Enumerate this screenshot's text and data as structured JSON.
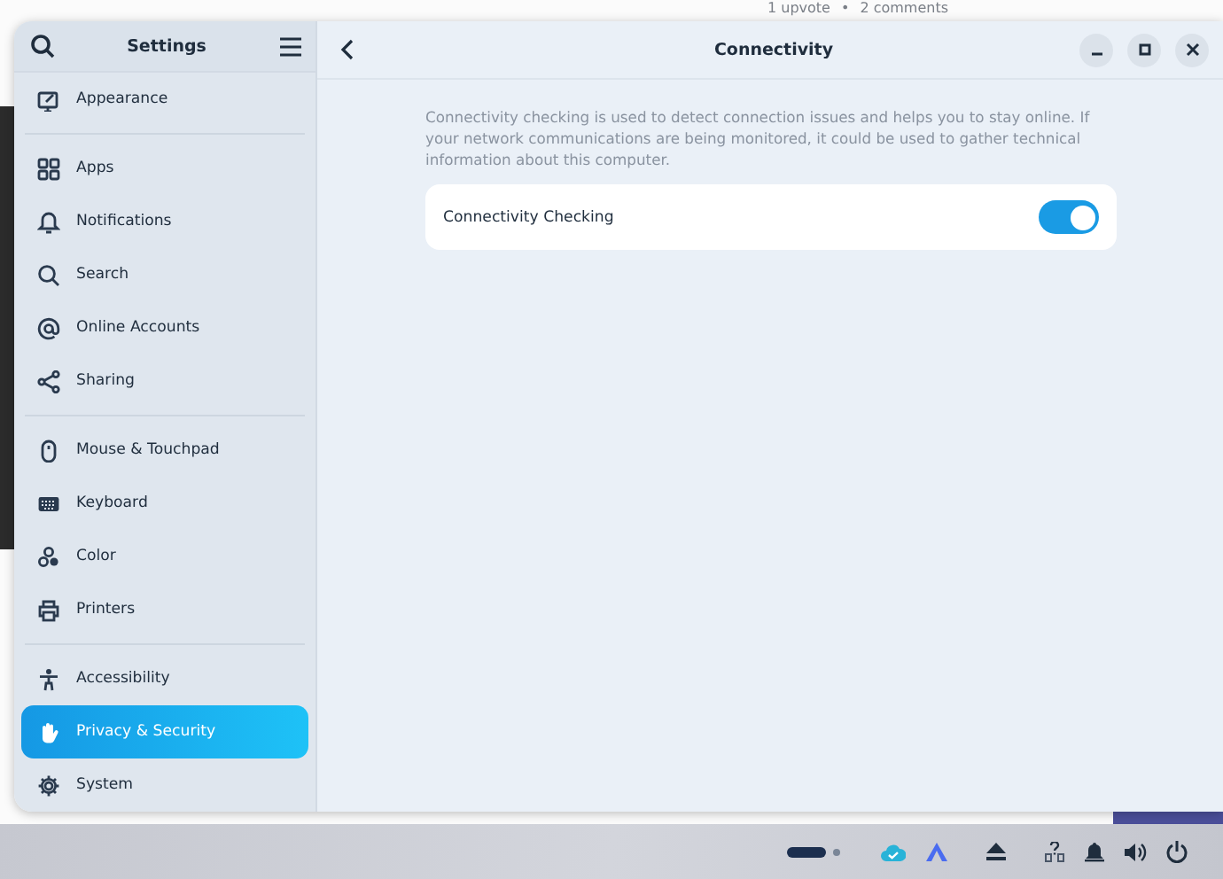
{
  "background_page": {
    "meta": "1 upvote",
    "separator": "•",
    "comments": "2 comments"
  },
  "sidebar": {
    "title": "Settings",
    "groups": [
      [
        {
          "label": "Appearance",
          "selected": false
        }
      ],
      [
        {
          "label": "Apps",
          "selected": false
        },
        {
          "label": "Notifications",
          "selected": false
        },
        {
          "label": "Search",
          "selected": false
        },
        {
          "label": "Online Accounts",
          "selected": false
        },
        {
          "label": "Sharing",
          "selected": false
        }
      ],
      [
        {
          "label": "Mouse & Touchpad",
          "selected": false
        },
        {
          "label": "Keyboard",
          "selected": false
        },
        {
          "label": "Color",
          "selected": false
        },
        {
          "label": "Printers",
          "selected": false
        }
      ],
      [
        {
          "label": "Accessibility",
          "selected": false
        },
        {
          "label": "Privacy & Security",
          "selected": true
        },
        {
          "label": "System",
          "selected": false
        }
      ]
    ]
  },
  "content": {
    "title": "Connectivity",
    "description": "Connectivity checking is used to detect connection issues and helps you to stay online. If your network communications are being monitored, it could be used to gather technical information about this computer.",
    "rows": [
      {
        "label": "Connectivity Checking",
        "on": true
      }
    ]
  }
}
